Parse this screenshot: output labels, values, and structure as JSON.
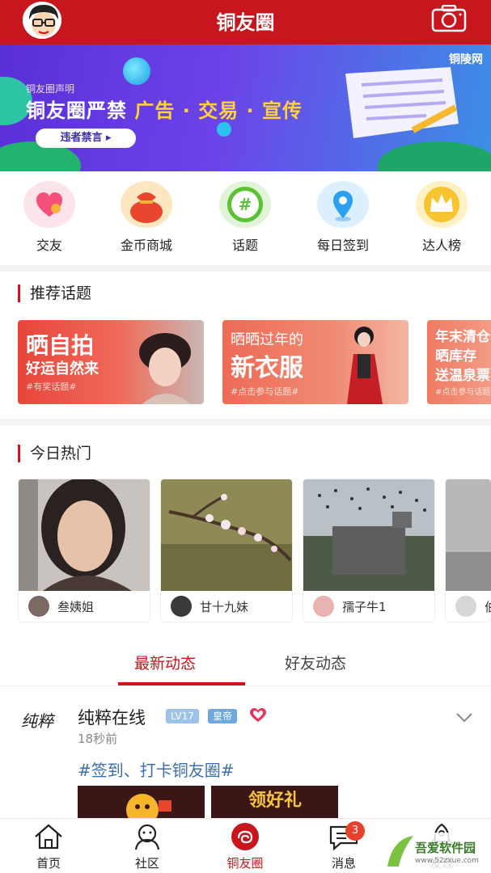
{
  "header": {
    "title": "铜友圈"
  },
  "banner": {
    "notice": "铜友圈声明",
    "headline_prefix": "铜友圈严禁",
    "headline_highlight": "广告 · 交易 · 宣传",
    "button": "违者禁言 ▸",
    "logo": "铜陵网"
  },
  "quick_icons": [
    {
      "label": "交友",
      "icon": "heart-icon",
      "color": "#f26a8f"
    },
    {
      "label": "金币商城",
      "icon": "money-bag-icon",
      "color": "#f5a623"
    },
    {
      "label": "话题",
      "icon": "hash-icon",
      "color": "#5bc236"
    },
    {
      "label": "每日签到",
      "icon": "location-pin-icon",
      "color": "#2d9ff0"
    },
    {
      "label": "达人榜",
      "icon": "crown-icon",
      "color": "#f7c32e"
    }
  ],
  "recommended": {
    "title": "推荐话题",
    "topics": [
      {
        "line1": "晒自拍",
        "line2": "好运自然来",
        "tag": "#有奖话题#"
      },
      {
        "line1": "晒晒过年的",
        "line2": "新衣服",
        "tag": "#点击参与话题#"
      },
      {
        "line1": "年末清仓",
        "line2": "晒库存",
        "line3": "送温泉票",
        "tag": "#点击参与话题#"
      }
    ]
  },
  "hot": {
    "title": "今日热门",
    "items": [
      {
        "name": "叁姨姐"
      },
      {
        "name": "甘十九妹"
      },
      {
        "name": "孺子牛1"
      },
      {
        "name": "伯"
      }
    ]
  },
  "tabs": [
    {
      "label": "最新动态",
      "active": true
    },
    {
      "label": "好友动态",
      "active": false
    }
  ],
  "post": {
    "signature": "纯粹",
    "name": "纯粹在线",
    "level": "LV17",
    "rank": "皇帝",
    "time": "18秒前",
    "tag": "#签到、打卡铜友圈#",
    "image2_text": "领好礼"
  },
  "bottom_nav": [
    {
      "label": "首页",
      "icon": "home-icon"
    },
    {
      "label": "社区",
      "icon": "community-icon"
    },
    {
      "label": "铜友圈",
      "icon": "tongyouquan-icon",
      "active": true
    },
    {
      "label": "消息",
      "icon": "message-icon",
      "badge": "3"
    },
    {
      "label": "发现",
      "icon": "rocket-icon"
    }
  ],
  "watermark": {
    "line1": "吾爱软件园",
    "line2": "www.52zxue.com"
  }
}
